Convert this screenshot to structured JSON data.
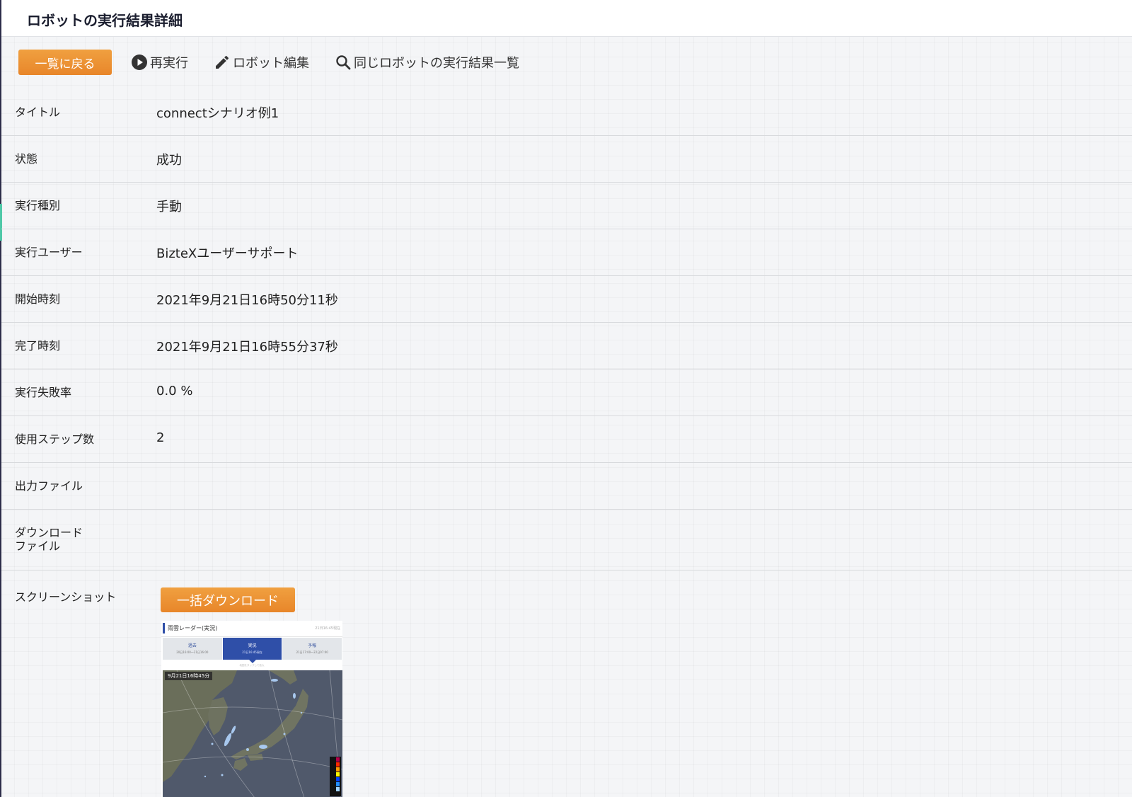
{
  "page": {
    "title": "ロボットの実行結果詳細"
  },
  "toolbar": {
    "back_label": "一覧に戻る",
    "rerun_label": "再実行",
    "edit_label": "ロボット編集",
    "history_label": "同じロボットの実行結果一覧"
  },
  "details": {
    "title": {
      "label": "タイトル",
      "value": "connectシナリオ例1"
    },
    "status": {
      "label": "状態",
      "value": "成功"
    },
    "run_type": {
      "label": "実行種別",
      "value": "手動"
    },
    "user": {
      "label": "実行ユーザー",
      "value": "BizteXユーザーサポート"
    },
    "start_time": {
      "label": "開始時刻",
      "value": "2021年9月21日16時50分11秒"
    },
    "end_time": {
      "label": "完了時刻",
      "value": "2021年9月21日16時55分37秒"
    },
    "failure_rate": {
      "label": "実行失敗率",
      "value": "0.0 %"
    },
    "steps": {
      "label": "使用ステップ数",
      "value": "2"
    },
    "output_file": {
      "label": "出力ファイル",
      "value": ""
    },
    "download_file": {
      "label_line1": "ダウンロード",
      "label_line2": "ファイル",
      "value": ""
    }
  },
  "screenshots": {
    "label": "スクリーンショット",
    "bulk_download_label": "一括ダウンロード",
    "thumbnail": {
      "title": "雨雲レーダー(実況)",
      "time": "21日16:45現在",
      "tabs": [
        {
          "label": "過去",
          "range": "20日16:00〜21日16:00"
        },
        {
          "label": "実況",
          "range": "21日16:45現在"
        },
        {
          "label": "予報",
          "range": "21日17:00〜22日07:00"
        }
      ],
      "caption": "地図をタップして拡大",
      "map_time": "9月21日16時45分"
    }
  },
  "colors": {
    "accent_orange": "#e8862a",
    "nav_blue": "#2f4fa8",
    "side_accent": "#4fc8a8"
  },
  "icons": {
    "rerun": "play-circle-icon",
    "edit": "pencil-icon",
    "history": "search-icon"
  }
}
